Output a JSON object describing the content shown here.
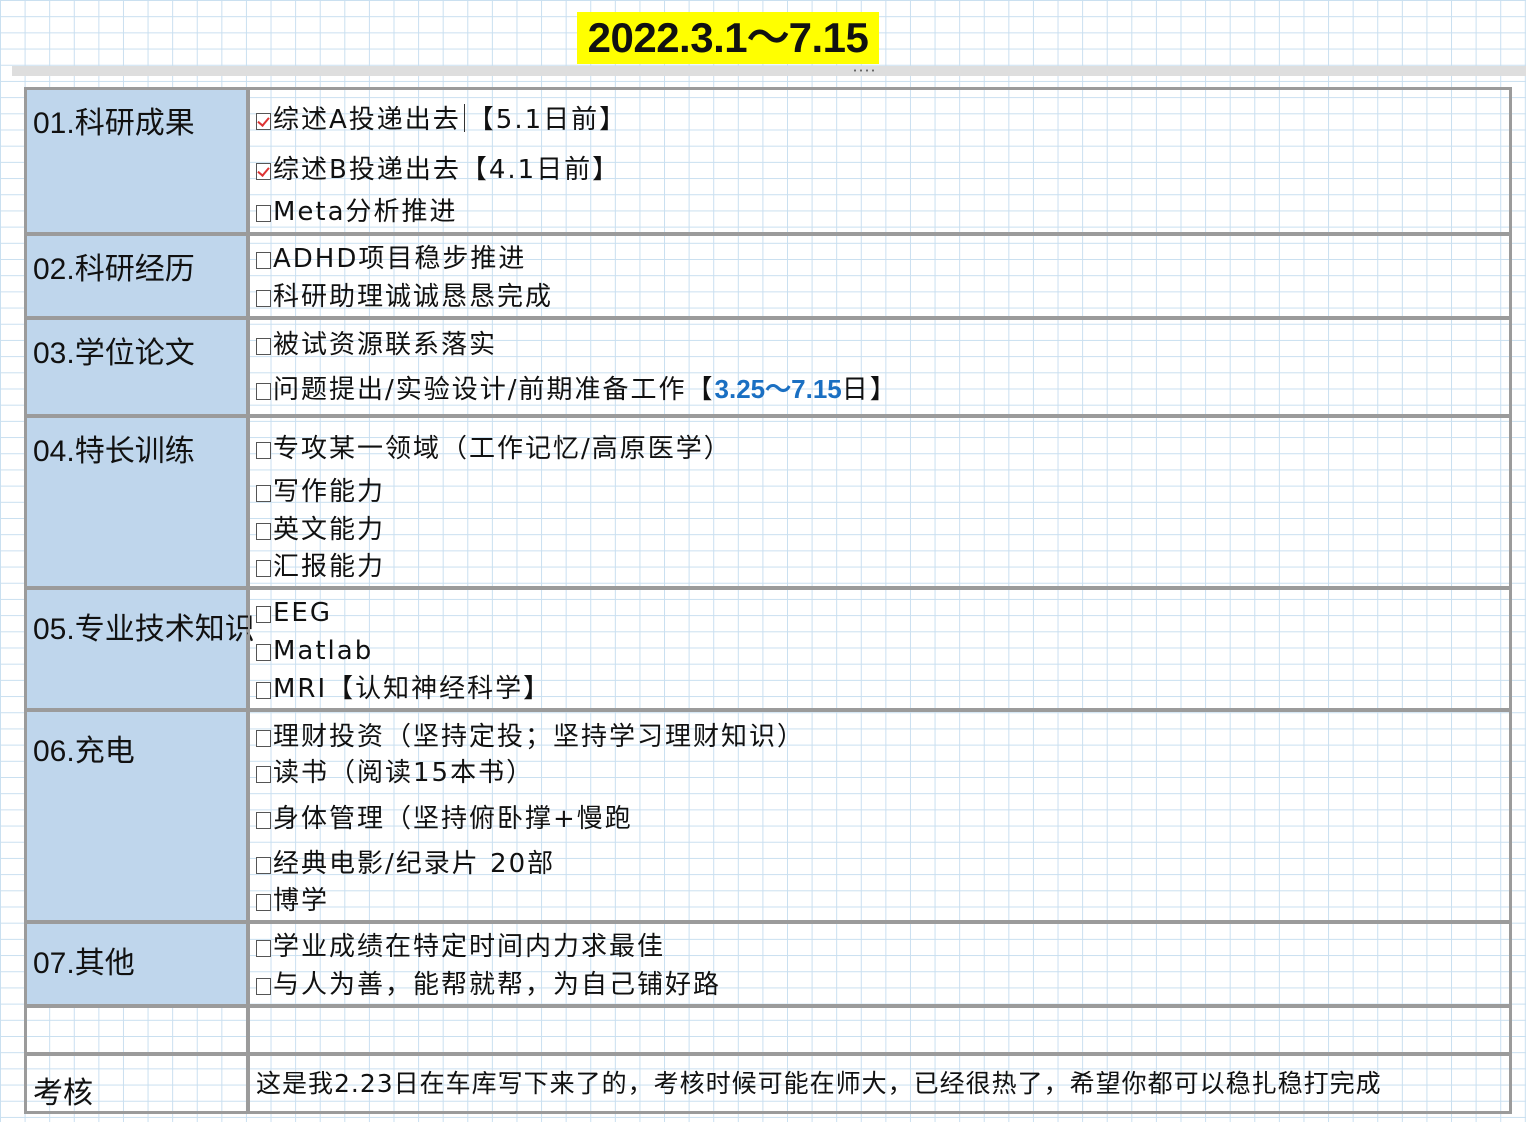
{
  "title": "2022.3.1～7.15",
  "sections": [
    {
      "label": "01.科研成果",
      "items": [
        {
          "before": "综述A投递出去",
          "after": "【5.1日前】",
          "checked": true
        },
        {
          "text": "综述B投递出去【4.1日前】",
          "checked": true
        },
        {
          "text": "Meta分析推进",
          "checked": false
        }
      ]
    },
    {
      "label": "02.科研经历",
      "items": [
        {
          "text": "ADHD项目稳步推进",
          "checked": false
        },
        {
          "text": "科研助理诚诚恳恳完成",
          "checked": false
        }
      ]
    },
    {
      "label": "03.学位论文",
      "items": [
        {
          "text": "被试资源联系落实",
          "checked": false
        },
        {
          "text": "问题提出/实验设计/前期准备工作【",
          "accent": "3.25～7.15",
          "tail": "日】",
          "checked": false
        }
      ]
    },
    {
      "label": "04.特长训练",
      "items": [
        {
          "text": "专攻某一领域（工作记忆/高原医学）",
          "checked": false
        },
        {
          "text": "写作能力",
          "checked": false
        },
        {
          "text": "英文能力",
          "checked": false
        },
        {
          "text": "汇报能力",
          "checked": false
        }
      ]
    },
    {
      "label": "05.专业技术知识",
      "items": [
        {
          "text": "EEG",
          "checked": false
        },
        {
          "text": "Matlab",
          "checked": false
        },
        {
          "text": "MRI【认知神经科学】",
          "checked": false
        }
      ]
    },
    {
      "label": "06.充电",
      "items": [
        {
          "text": "理财投资（坚持定投；坚持学习理财知识）",
          "checked": false
        },
        {
          "text": "读书（阅读15本书）",
          "checked": false
        },
        {
          "text": "身体管理（坚持俯卧撑+慢跑",
          "checked": false
        },
        {
          "text": "经典电影/纪录片 20部",
          "checked": false
        },
        {
          "text": "博学",
          "checked": false
        }
      ]
    },
    {
      "label": "07.其他",
      "items": [
        {
          "text": "学业成绩在特定时间内力求最佳",
          "checked": false
        },
        {
          "text": "与人为善，能帮就帮，为自己铺好路",
          "checked": false
        }
      ]
    }
  ],
  "blank_row": {
    "label": "",
    "text": ""
  },
  "assessment": {
    "label": "考核",
    "text": "这是我2.23日在车库写下来了的，考核时候可能在师大，已经很热了，希望你都可以稳扎稳打完成"
  }
}
